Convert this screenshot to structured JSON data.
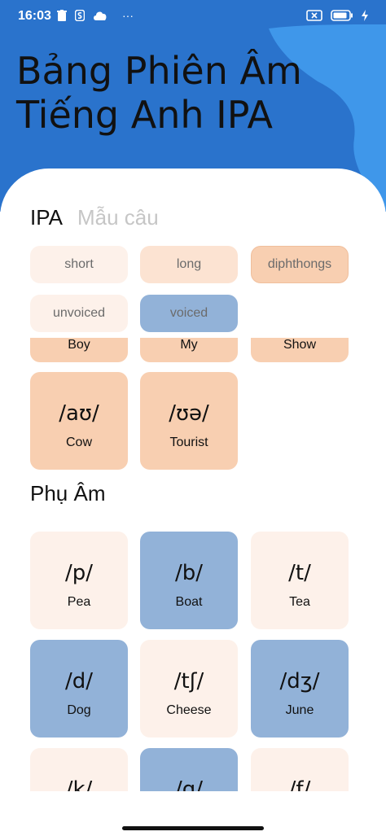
{
  "status_bar": {
    "time": "16:03",
    "more": "···"
  },
  "title": {
    "line1": "Bảng Phiên Âm",
    "line2": "Tiếng Anh IPA"
  },
  "tabs": [
    {
      "label": "IPA"
    },
    {
      "label": "Mẫu câu"
    }
  ],
  "filters": [
    "short",
    "long",
    "diphthongs",
    "unvoiced",
    "voiced"
  ],
  "diphthongs_partial": [
    {
      "word": "Boy"
    },
    {
      "word": "My"
    },
    {
      "word": "Show"
    }
  ],
  "diphthongs": [
    {
      "symbol": "/aʊ/",
      "word": "Cow"
    },
    {
      "symbol": "/ʊə/",
      "word": "Tourist"
    }
  ],
  "consonants_title": "Phụ Âm",
  "consonants": [
    {
      "symbol": "/p/",
      "word": "Pea"
    },
    {
      "symbol": "/b/",
      "word": "Boat"
    },
    {
      "symbol": "/t/",
      "word": "Tea"
    },
    {
      "symbol": "/d/",
      "word": "Dog"
    },
    {
      "symbol": "/tʃ/",
      "word": "Cheese"
    },
    {
      "symbol": "/dʒ/",
      "word": "June"
    },
    {
      "symbol": "/k/",
      "word": ""
    },
    {
      "symbol": "/g/",
      "word": ""
    },
    {
      "symbol": "/f/",
      "word": ""
    }
  ],
  "colors": {
    "header": "#2a73cc",
    "wave": "#3f97ea",
    "peach": "#f8cfb1",
    "light": "#fdf1ea",
    "blue": "#92b2d8"
  },
  "icons": [
    "trash-icon",
    "s-icon",
    "cloud-icon",
    "battery-icon",
    "sim-icon",
    "charging-icon"
  ]
}
